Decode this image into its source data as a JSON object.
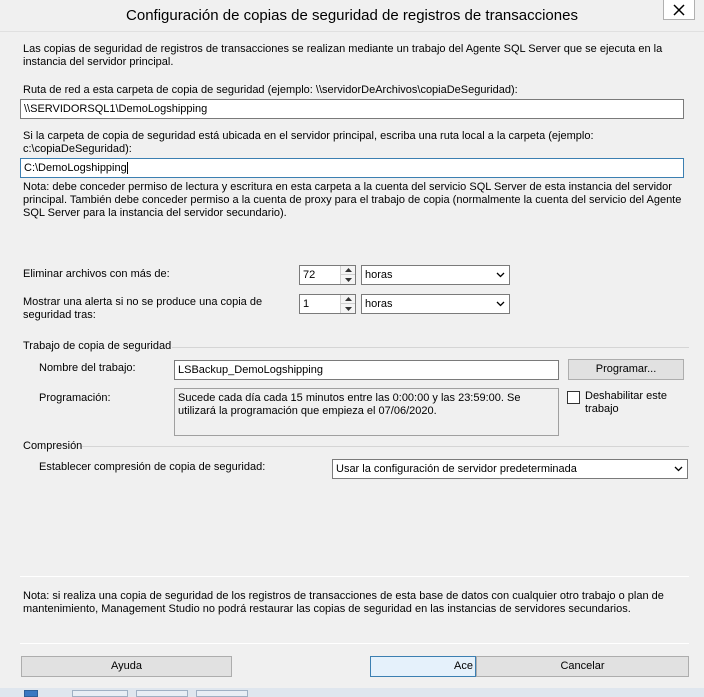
{
  "window": {
    "title": "Configuración de copias de seguridad de registros de transacciones"
  },
  "intro_text": "Las copias de seguridad de registros de transacciones se realizan mediante un trabajo del Agente SQL Server que se ejecuta en la instancia del servidor principal.",
  "network_path": {
    "label": "Ruta de red a esta carpeta de copia de seguridad (ejemplo: \\\\servidorDeArchivos\\copiaDeSeguridad):",
    "value": "\\\\SERVIDORSQL1\\DemoLogshipping"
  },
  "local_path": {
    "label": "Si la carpeta de copia de seguridad está ubicada en el servidor principal, escriba una ruta local a la carpeta (ejemplo: c:\\copiaDeSeguridad):",
    "value": "C:\\DemoLogshipping"
  },
  "permission_note": "Nota: debe conceder permiso de lectura y escritura en esta carpeta a la cuenta del servicio SQL Server de esta instancia del servidor principal. También debe conceder permiso a la cuenta de proxy para el trabajo de copia (normalmente la cuenta del servicio del Agente SQL Server para la instancia del servidor secundario).",
  "delete_files": {
    "label": "Eliminar archivos con más de:",
    "value": "72",
    "unit": "horas"
  },
  "alert": {
    "label": "Mostrar una alerta si no se produce una copia de seguridad tras:",
    "value": "1",
    "unit": "horas"
  },
  "backup_job": {
    "group_label": "Trabajo de copia de seguridad",
    "name_label": "Nombre del trabajo:",
    "name_value": "LSBackup_DemoLogshipping",
    "schedule_button": "Programar...",
    "schedule_label": "Programación:",
    "schedule_text": "Sucede cada día cada 15 minutos entre las 0:00:00 y las 23:59:00. Se utilizará la programación que empieza el 07/06/2020.",
    "disable_label": "Deshabilitar este trabajo",
    "disable_checked": false
  },
  "compression": {
    "group_label": "Compresión",
    "label": "Establecer compresión de copia de seguridad:",
    "value": "Usar la configuración de servidor predeterminada"
  },
  "bottom_note": "Nota: si realiza una copia de seguridad de los registros de transacciones de esta base de datos con cualquier otro trabajo o plan de mantenimiento, Management Studio no podrá restaurar las copias de seguridad en las instancias de servidores secundarios.",
  "buttons": {
    "help": "Ayuda",
    "ok": "Ace",
    "cancel": "Cancelar"
  },
  "colors": {
    "background": "#f0f0f0",
    "focus_border": "#3c7fb1"
  }
}
